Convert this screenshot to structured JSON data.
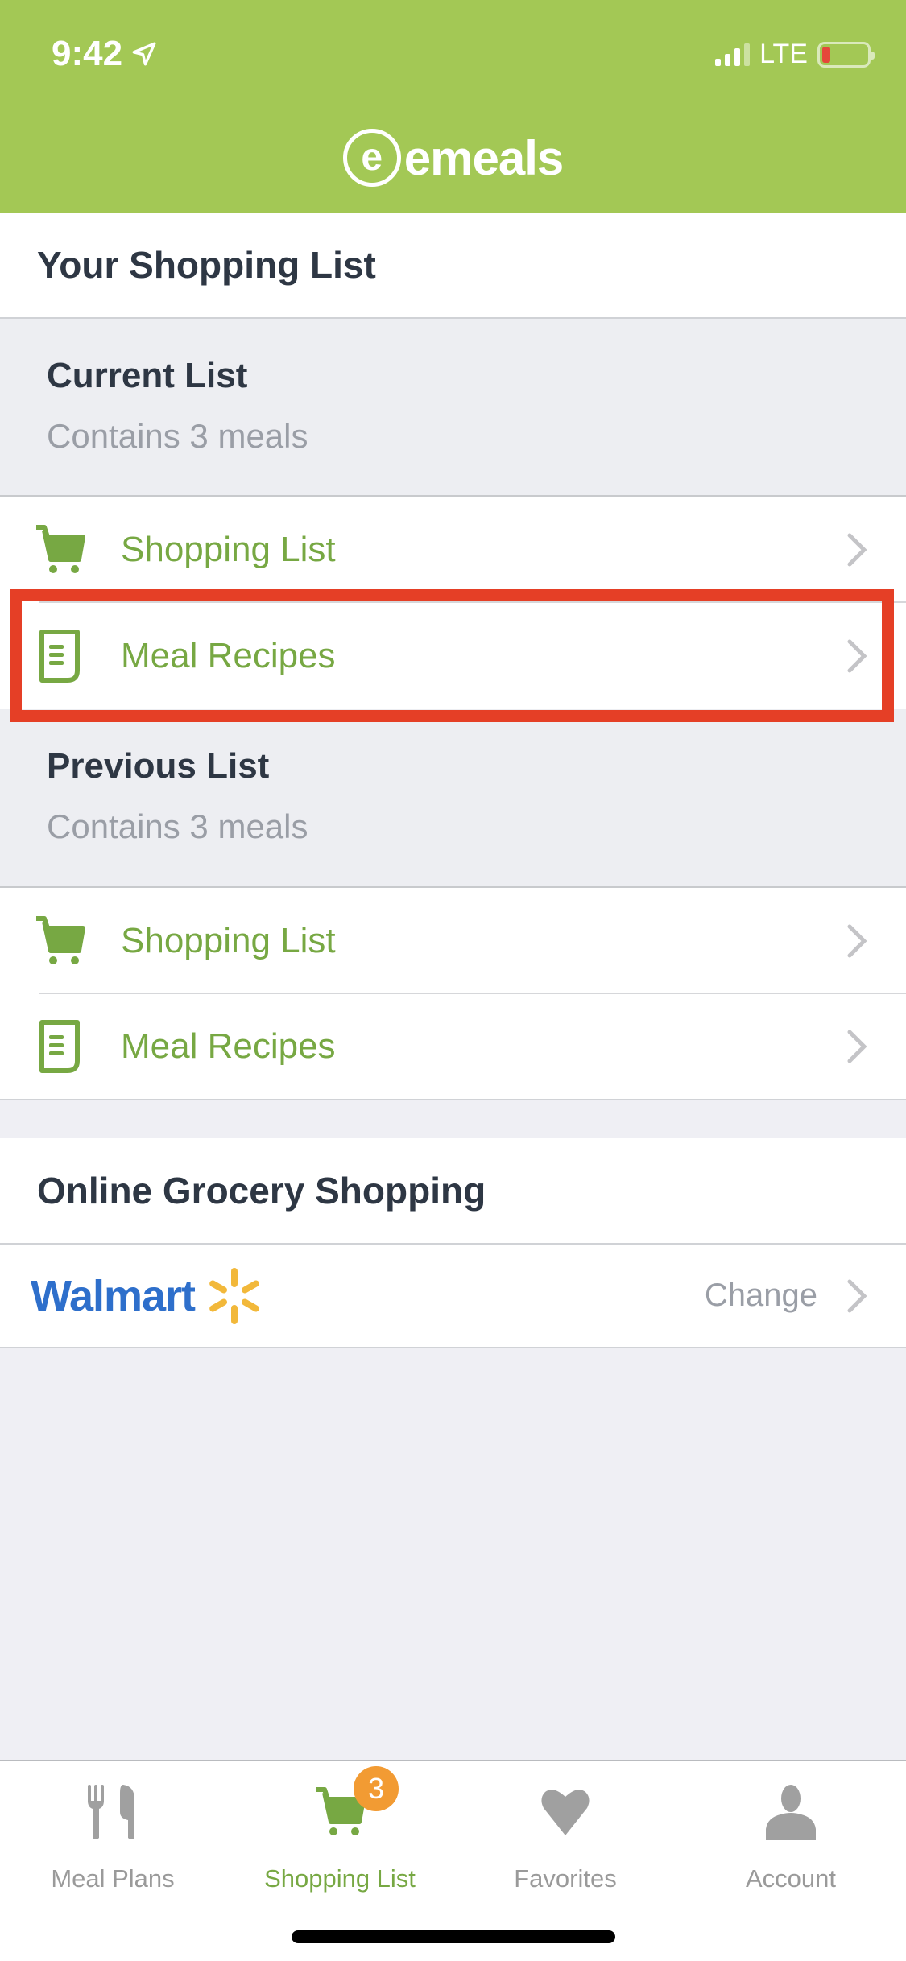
{
  "status_bar": {
    "time": "9:42",
    "network": "LTE",
    "location_icon": "location-arrow-icon",
    "battery_level": 0.1
  },
  "header": {
    "logo_mark": "e",
    "logo_text": "emeals"
  },
  "page": {
    "title": "Your Shopping List"
  },
  "current_list": {
    "title": "Current List",
    "subtitle": "Contains 3 meals",
    "items": [
      {
        "label": "Shopping List",
        "icon": "cart-icon"
      },
      {
        "label": "Meal Recipes",
        "icon": "document-icon"
      }
    ]
  },
  "previous_list": {
    "title": "Previous List",
    "subtitle": "Contains 3 meals",
    "items": [
      {
        "label": "Shopping List",
        "icon": "cart-icon"
      },
      {
        "label": "Meal Recipes",
        "icon": "document-icon"
      }
    ]
  },
  "online_grocery": {
    "title": "Online Grocery Shopping",
    "store": "Walmart",
    "action_label": "Change"
  },
  "tabbar": {
    "tabs": [
      {
        "label": "Meal Plans",
        "icon": "fork-knife-icon",
        "active": false
      },
      {
        "label": "Shopping List",
        "icon": "cart-icon",
        "active": true,
        "badge": "3"
      },
      {
        "label": "Favorites",
        "icon": "heart-icon",
        "active": false
      },
      {
        "label": "Account",
        "icon": "person-icon",
        "active": false
      }
    ]
  },
  "colors": {
    "brand_green": "#a3c855",
    "link_green": "#77a843",
    "highlight_red": "#e53f26",
    "badge_orange": "#f29b33",
    "walmart_blue": "#2e6fcb",
    "walmart_yellow": "#f2b83a"
  }
}
